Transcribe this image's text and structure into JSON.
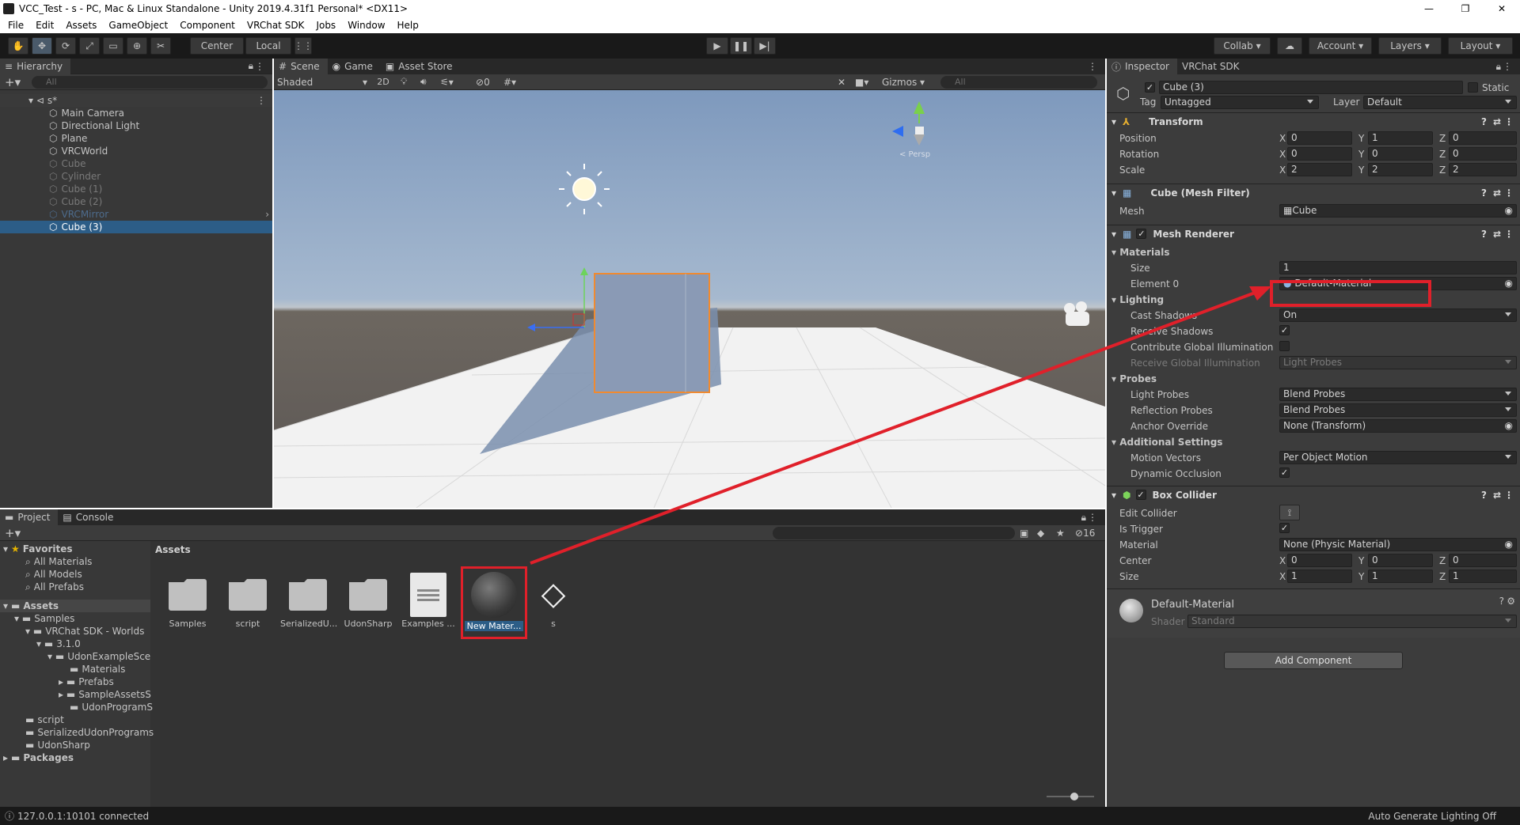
{
  "window": {
    "title": "VCC_Test - s - PC, Mac & Linux Standalone - Unity 2019.4.31f1 Personal* <DX11>"
  },
  "menu": [
    "File",
    "Edit",
    "Assets",
    "GameObject",
    "Component",
    "VRChat SDK",
    "Jobs",
    "Window",
    "Help"
  ],
  "toolbar": {
    "pivot": "Center",
    "space": "Local",
    "collab": "Collab",
    "account": "Account",
    "layers": "Layers",
    "layout": "Layout"
  },
  "hierarchy": {
    "tab": "Hierarchy",
    "search_placeholder": "All",
    "scene": "s*",
    "items": [
      "Main Camera",
      "Directional Light",
      "Plane",
      "VRCWorld",
      "Cube",
      "Cylinder",
      "Cube (1)",
      "Cube (2)",
      "VRCMirror",
      "Cube (3)"
    ]
  },
  "scene": {
    "tabs": [
      "Scene",
      "Game",
      "Asset Store"
    ],
    "shading": "Shaded",
    "mode2d": "2D",
    "hidden_count": "0",
    "gizmos": "Gizmos",
    "search_placeholder": "All",
    "persp": "< Persp"
  },
  "project": {
    "tabs": [
      "Project",
      "Console"
    ],
    "hidden_count": "16",
    "breadcrumb": "Assets",
    "favorites": {
      "label": "Favorites",
      "items": [
        "All Materials",
        "All Models",
        "All Prefabs"
      ]
    },
    "tree": [
      "Assets",
      "Samples",
      "VRChat SDK - Worlds",
      "3.1.0",
      "UdonExampleSce",
      "Materials",
      "Prefabs",
      "SampleAssetsS",
      "UdonProgramS",
      "script",
      "SerializedUdonPrograms",
      "UdonSharp",
      "Packages"
    ],
    "assets": [
      "Samples",
      "script",
      "SerializedU...",
      "UdonSharp",
      "Examples ...",
      "New Mater...",
      "s"
    ]
  },
  "inspector": {
    "tabs": [
      "Inspector",
      "VRChat SDK"
    ],
    "object_name": "Cube (3)",
    "static_label": "Static",
    "tag_label": "Tag",
    "tag": "Untagged",
    "layer_label": "Layer",
    "layer": "Default",
    "transform": {
      "title": "Transform",
      "rows": [
        {
          "label": "Position",
          "x": "0",
          "y": "1",
          "z": "0"
        },
        {
          "label": "Rotation",
          "x": "0",
          "y": "0",
          "z": "0"
        },
        {
          "label": "Scale",
          "x": "2",
          "y": "2",
          "z": "2"
        }
      ]
    },
    "mesh_filter": {
      "title": "Cube (Mesh Filter)",
      "mesh_label": "Mesh",
      "mesh": "Cube"
    },
    "mesh_renderer": {
      "title": "Mesh Renderer",
      "materials": "Materials",
      "size_label": "Size",
      "size": "1",
      "element_label": "Element 0",
      "element": "Default-Material",
      "lighting": "Lighting",
      "cast_shadows_label": "Cast Shadows",
      "cast_shadows": "On",
      "receive_shadows_label": "Receive Shadows",
      "contribute_gi_label": "Contribute Global Illumination",
      "receive_gi_label": "Receive Global Illumination",
      "receive_gi": "Light Probes",
      "probes": "Probes",
      "light_probes_label": "Light Probes",
      "light_probes": "Blend Probes",
      "reflection_probes_label": "Reflection Probes",
      "reflection_probes": "Blend Probes",
      "anchor_label": "Anchor Override",
      "anchor": "None (Transform)",
      "additional": "Additional Settings",
      "motion_label": "Motion Vectors",
      "motion": "Per Object Motion",
      "occlusion_label": "Dynamic Occlusion"
    },
    "box_collider": {
      "title": "Box Collider",
      "edit_label": "Edit Collider",
      "trigger_label": "Is Trigger",
      "material_label": "Material",
      "material": "None (Physic Material)",
      "center": {
        "label": "Center",
        "x": "0",
        "y": "0",
        "z": "0"
      },
      "size": {
        "label": "Size",
        "x": "1",
        "y": "1",
        "z": "1"
      }
    },
    "material": {
      "name": "Default-Material",
      "shader_label": "Shader",
      "shader": "Standard"
    },
    "add_component": "Add Component"
  },
  "status": {
    "left": "127.0.0.1:10101 connected",
    "right": "Auto Generate Lighting Off"
  },
  "colors": {
    "highlight": "#e0202a",
    "selection": "#2c5d87",
    "accent_orange": "#f08a30"
  }
}
